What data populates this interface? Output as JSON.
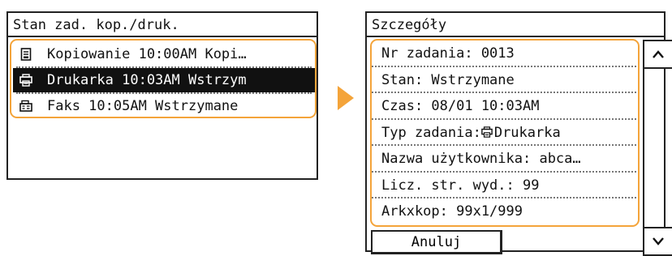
{
  "left_screen": {
    "title": "Stan zad. kop./druk.",
    "jobs": [
      {
        "icon": "copy-icon",
        "text": "Kopiowanie 10:00AM Kopi…",
        "selected": false
      },
      {
        "icon": "printer-icon",
        "text": "Drukarka 10:03AM Wstrzym",
        "selected": true
      },
      {
        "icon": "fax-icon",
        "text": "Faks 10:05AM Wstrzymane",
        "selected": false
      }
    ]
  },
  "right_screen": {
    "title": "Szczegóły",
    "details": {
      "job_number": "Nr zadania: 0013",
      "status": "Stan: Wstrzymane",
      "time": "Czas: 08/01 10:03AM",
      "job_type_label": "Typ zadania:",
      "job_type_value": "Drukarka",
      "user_name": "Nazwa użytkownika: abca…",
      "pages": "Licz. str. wyd.: 99",
      "sheets_copies": "Arkxkop: 99x1/999"
    },
    "cancel_label": "Anuluj"
  },
  "colors": {
    "highlight": "#f4a43a",
    "selected_bg": "#111111",
    "arrow": "#f4a43a"
  }
}
